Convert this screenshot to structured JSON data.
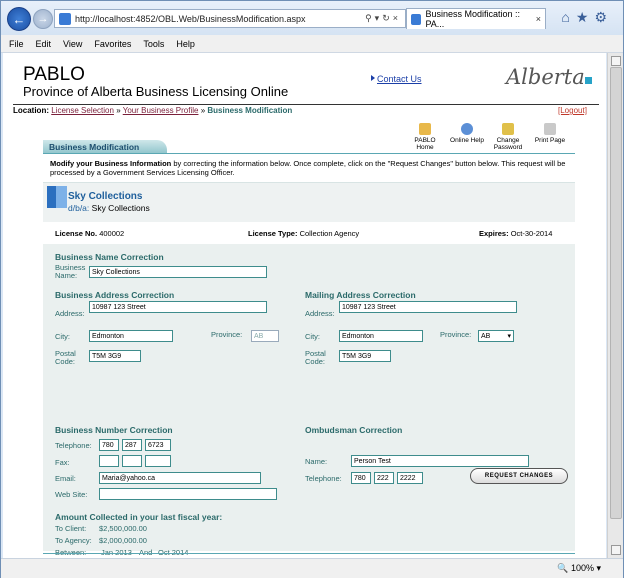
{
  "browser": {
    "url": "http://localhost:4852/OBL.Web/BusinessModification.aspx",
    "tab_title": "Business Modification :: PA...",
    "menu": [
      "File",
      "Edit",
      "View",
      "Favorites",
      "Tools",
      "Help"
    ],
    "zoom": "100%"
  },
  "header": {
    "title": "PABLO",
    "subtitle": "Province of Alberta Business Licensing Online",
    "contact_link": "Contact Us",
    "logo_text": "Alberta"
  },
  "location": {
    "label": "Location:",
    "crumb1": "License Selection",
    "sep": "»",
    "crumb2": "Your Business Profile",
    "current": "Business Modification",
    "logout": "[Logout]"
  },
  "toolbar": {
    "home": "PABLO Home",
    "help": "Online Help",
    "password": "Change Password",
    "print": "Print Page"
  },
  "panel": {
    "tab_title": "Business Modification",
    "intro_bold": "Modify your Business Information",
    "intro_rest": " by correcting the information below. Once complete, click on the \"Request Changes\" button below. This request will be processed by a Government Services Licensing Officer."
  },
  "company": {
    "name": "Sky Collections",
    "dba_label": "d/b/a:",
    "dba_value": "Sky Collections"
  },
  "license": {
    "no_label": "License No.",
    "no_value": "400002",
    "type_label": "License Type:",
    "type_value": "Collection Agency",
    "expires_label": "Expires:",
    "expires_value": "Oct-30-2014"
  },
  "form": {
    "name_section": "Business Name Correction",
    "business_name_label": "Business Name:",
    "business_name_value": "Sky Collections",
    "address_section": "Business Address Correction",
    "mailing_section": "Mailing Address Correction",
    "address_label": "Address:",
    "address_value": "10987 123 Street",
    "mail_address_value": "10987 123 Street",
    "city_label": "City:",
    "city_value": "Edmonton",
    "mail_city_value": "Edmonton",
    "province_label": "Province:",
    "province_value": "AB",
    "mail_province_value": "AB",
    "postal_label": "Postal Code:",
    "postal_value": "T5M 3G9",
    "mail_postal_value": "T5M 3G9",
    "number_section": "Business Number Correction",
    "ombudsman_section": "Ombudsman Correction",
    "telephone_label": "Telephone:",
    "tel_area": "780",
    "tel_prefix": "287",
    "tel_line": "6723",
    "fax_label": "Fax:",
    "email_label": "Email:",
    "email_value": "Maria@yahoo.ca",
    "website_label": "Web Site:",
    "omb_name_label": "Name:",
    "omb_name_value": "Person Test",
    "omb_tel_area": "780",
    "omb_tel_prefix": "222",
    "omb_tel_line": "2222",
    "amount_section": "Amount Collected in your last fiscal year:",
    "to_client_label": "To Client:",
    "to_client_value": "$2,500,000.00",
    "to_agency_label": "To Agency:",
    "to_agency_value": "$2,000,000.00",
    "between_label": "Between:",
    "between_from": "Jan 2013",
    "between_and": "And",
    "between_to": "Oct 2014",
    "request_button": "REQUEST CHANGES"
  }
}
